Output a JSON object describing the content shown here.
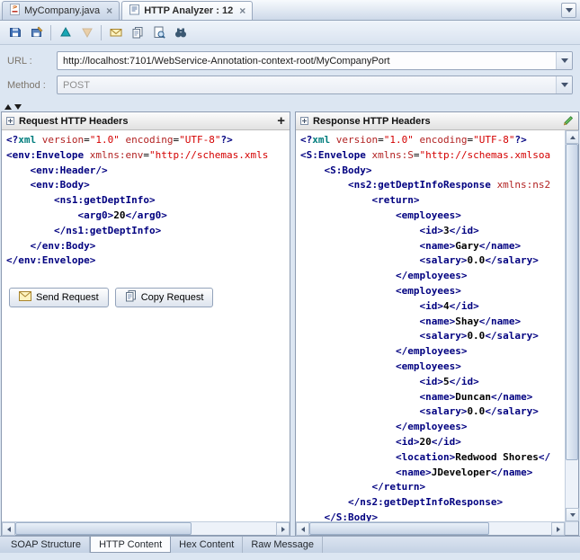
{
  "doc_tabs": {
    "close_glyph": "×",
    "tabs": [
      {
        "label": "MyCompany.java"
      },
      {
        "label": "HTTP Analyzer : 12"
      }
    ]
  },
  "toolbar": {
    "icons": [
      "save-icon",
      "save-as-icon",
      "resend-up-icon",
      "download-down-icon",
      "send-mail-icon",
      "copy-icon",
      "page-find-icon",
      "binoculars-icon"
    ]
  },
  "request_form": {
    "url_label": "URL :",
    "url_value": "http://localhost:7101/WebService-Annotation-context-root/MyCompanyPort",
    "method_label": "Method :",
    "method_value": "POST"
  },
  "request_panel": {
    "title": "Request HTTP Headers",
    "send_button": "Send Request",
    "copy_button": "Copy Request",
    "xml_lines": [
      [
        [
          "tag",
          "<?"
        ],
        [
          "pi",
          "xml"
        ],
        [
          "pln",
          " "
        ],
        [
          "attr",
          "version"
        ],
        [
          "pln",
          "="
        ],
        [
          "val",
          "\"1.0\""
        ],
        [
          "pln",
          " "
        ],
        [
          "attr",
          "encoding"
        ],
        [
          "pln",
          "="
        ],
        [
          "val",
          "\"UTF-8\""
        ],
        [
          "tag",
          "?>"
        ]
      ],
      [
        [
          "tag",
          "<env:Envelope"
        ],
        [
          "pln",
          " "
        ],
        [
          "attr",
          "xmlns:env"
        ],
        [
          "pln",
          "="
        ],
        [
          "val",
          "\"http://schemas.xmls"
        ]
      ],
      [
        [
          "pln",
          "    "
        ],
        [
          "tag",
          "<env:Header/>"
        ]
      ],
      [
        [
          "pln",
          "    "
        ],
        [
          "tag",
          "<env:Body>"
        ]
      ],
      [
        [
          "pln",
          "        "
        ],
        [
          "tag",
          "<ns1:getDeptInfo>"
        ]
      ],
      [
        [
          "pln",
          "            "
        ],
        [
          "tag",
          "<arg0>"
        ],
        [
          "txt",
          "20"
        ],
        [
          "tag",
          "</arg0>"
        ]
      ],
      [
        [
          "pln",
          "        "
        ],
        [
          "tag",
          "</ns1:getDeptInfo>"
        ]
      ],
      [
        [
          "pln",
          "    "
        ],
        [
          "tag",
          "</env:Body>"
        ]
      ],
      [
        [
          "tag",
          "</env:Envelope>"
        ]
      ]
    ]
  },
  "response_panel": {
    "title": "Response HTTP Headers",
    "xml_lines": [
      [
        [
          "tag",
          "<?"
        ],
        [
          "pi",
          "xml"
        ],
        [
          "pln",
          " "
        ],
        [
          "attr",
          "version"
        ],
        [
          "pln",
          "="
        ],
        [
          "val",
          "\"1.0\""
        ],
        [
          "pln",
          " "
        ],
        [
          "attr",
          "encoding"
        ],
        [
          "pln",
          "="
        ],
        [
          "val",
          "\"UTF-8\""
        ],
        [
          "tag",
          "?>"
        ]
      ],
      [
        [
          "tag",
          "<S:Envelope"
        ],
        [
          "pln",
          " "
        ],
        [
          "attr",
          "xmlns:S"
        ],
        [
          "pln",
          "="
        ],
        [
          "val",
          "\"http://schemas.xmlsoa"
        ]
      ],
      [
        [
          "pln",
          "    "
        ],
        [
          "tag",
          "<S:Body>"
        ]
      ],
      [
        [
          "pln",
          "        "
        ],
        [
          "tag",
          "<ns2:getDeptInfoResponse"
        ],
        [
          "pln",
          " "
        ],
        [
          "attr",
          "xmlns:ns2"
        ]
      ],
      [
        [
          "pln",
          "            "
        ],
        [
          "tag",
          "<return>"
        ]
      ],
      [
        [
          "pln",
          "                "
        ],
        [
          "tag",
          "<employees>"
        ]
      ],
      [
        [
          "pln",
          "                    "
        ],
        [
          "tag",
          "<id>"
        ],
        [
          "txt",
          "3"
        ],
        [
          "tag",
          "</id>"
        ]
      ],
      [
        [
          "pln",
          "                    "
        ],
        [
          "tag",
          "<name>"
        ],
        [
          "txt",
          "Gary"
        ],
        [
          "tag",
          "</name>"
        ]
      ],
      [
        [
          "pln",
          "                    "
        ],
        [
          "tag",
          "<salary>"
        ],
        [
          "txt",
          "0.0"
        ],
        [
          "tag",
          "</salary>"
        ]
      ],
      [
        [
          "pln",
          "                "
        ],
        [
          "tag",
          "</employees>"
        ]
      ],
      [
        [
          "pln",
          "                "
        ],
        [
          "tag",
          "<employees>"
        ]
      ],
      [
        [
          "pln",
          "                    "
        ],
        [
          "tag",
          "<id>"
        ],
        [
          "txt",
          "4"
        ],
        [
          "tag",
          "</id>"
        ]
      ],
      [
        [
          "pln",
          "                    "
        ],
        [
          "tag",
          "<name>"
        ],
        [
          "txt",
          "Shay"
        ],
        [
          "tag",
          "</name>"
        ]
      ],
      [
        [
          "pln",
          "                    "
        ],
        [
          "tag",
          "<salary>"
        ],
        [
          "txt",
          "0.0"
        ],
        [
          "tag",
          "</salary>"
        ]
      ],
      [
        [
          "pln",
          "                "
        ],
        [
          "tag",
          "</employees>"
        ]
      ],
      [
        [
          "pln",
          "                "
        ],
        [
          "tag",
          "<employees>"
        ]
      ],
      [
        [
          "pln",
          "                    "
        ],
        [
          "tag",
          "<id>"
        ],
        [
          "txt",
          "5"
        ],
        [
          "tag",
          "</id>"
        ]
      ],
      [
        [
          "pln",
          "                    "
        ],
        [
          "tag",
          "<name>"
        ],
        [
          "txt",
          "Duncan"
        ],
        [
          "tag",
          "</name>"
        ]
      ],
      [
        [
          "pln",
          "                    "
        ],
        [
          "tag",
          "<salary>"
        ],
        [
          "txt",
          "0.0"
        ],
        [
          "tag",
          "</salary>"
        ]
      ],
      [
        [
          "pln",
          "                "
        ],
        [
          "tag",
          "</employees>"
        ]
      ],
      [
        [
          "pln",
          "                "
        ],
        [
          "tag",
          "<id>"
        ],
        [
          "txt",
          "20"
        ],
        [
          "tag",
          "</id>"
        ]
      ],
      [
        [
          "pln",
          "                "
        ],
        [
          "tag",
          "<location>"
        ],
        [
          "txt",
          "Redwood Shores"
        ],
        [
          "tag",
          "</"
        ]
      ],
      [
        [
          "pln",
          "                "
        ],
        [
          "tag",
          "<name>"
        ],
        [
          "txt",
          "JDeveloper"
        ],
        [
          "tag",
          "</name>"
        ]
      ],
      [
        [
          "pln",
          "            "
        ],
        [
          "tag",
          "</return>"
        ]
      ],
      [
        [
          "pln",
          "        "
        ],
        [
          "tag",
          "</ns2:getDeptInfoResponse>"
        ]
      ],
      [
        [
          "pln",
          "    "
        ],
        [
          "tag",
          "</S:Body>"
        ]
      ]
    ]
  },
  "bottom_tabs": {
    "active": "HTTP Content",
    "tabs": [
      "SOAP Structure",
      "HTTP Content",
      "Hex Content",
      "Raw Message"
    ]
  }
}
